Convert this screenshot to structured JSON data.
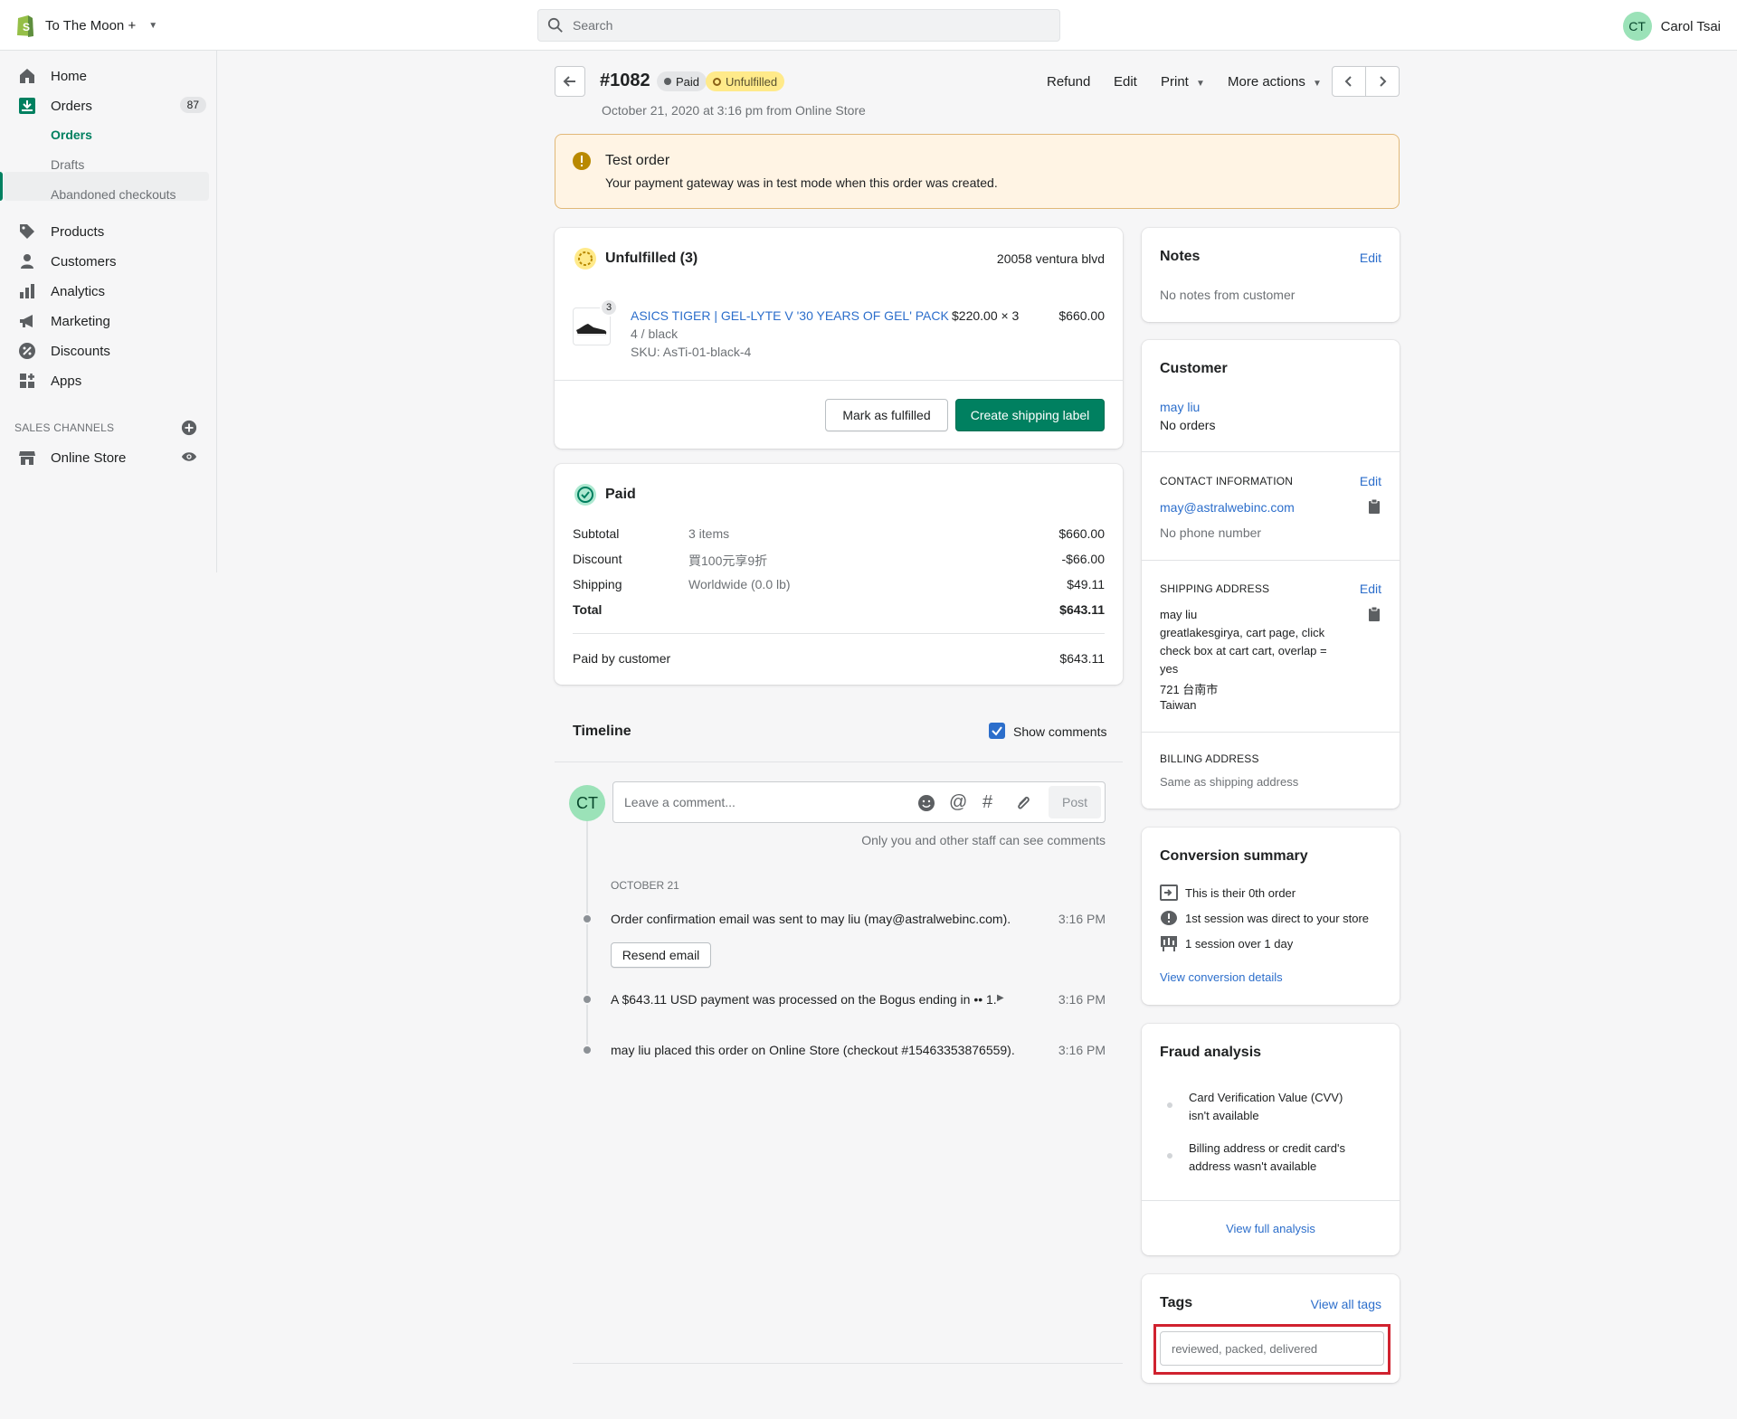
{
  "topbar": {
    "store_name": "To The Moon +",
    "search_placeholder": "Search",
    "user_initials": "CT",
    "user_name": "Carol Tsai"
  },
  "sidebar": {
    "home": "Home",
    "orders": "Orders",
    "orders_count": "87",
    "sub_orders": "Orders",
    "sub_drafts": "Drafts",
    "sub_abandoned": "Abandoned checkouts",
    "products": "Products",
    "customers": "Customers",
    "analytics": "Analytics",
    "marketing": "Marketing",
    "discounts": "Discounts",
    "apps": "Apps",
    "sales_channels": "SALES CHANNELS",
    "online_store": "Online Store"
  },
  "header": {
    "order_number": "#1082",
    "status_paid": "Paid",
    "status_unfulfilled": "Unfulfilled",
    "subline": "October 21, 2020 at 3:16 pm from Online Store",
    "refund": "Refund",
    "edit": "Edit",
    "print": "Print",
    "more_actions": "More actions"
  },
  "banner": {
    "title": "Test order",
    "text": "Your payment gateway was in test mode when this order was created."
  },
  "fulfillment": {
    "title": "Unfulfilled (3)",
    "location": "20058 ventura blvd",
    "qty_badge": "3",
    "product_name": "ASICS TIGER | GEL-LYTE V '30 YEARS OF GEL' PACK",
    "variant": "4 / black",
    "sku": "SKU: AsTi-01-black-4",
    "unit_price": "$220.00 × 3",
    "line_total": "$660.00",
    "mark_fulfilled": "Mark as fulfilled",
    "create_label": "Create shipping label"
  },
  "payment": {
    "title": "Paid",
    "rows": [
      {
        "label": "Subtotal",
        "desc": "3 items",
        "amount": "$660.00"
      },
      {
        "label": "Discount",
        "desc": "買100元享9折",
        "amount": "-$66.00"
      },
      {
        "label": "Shipping",
        "desc": "Worldwide (0.0 lb)",
        "amount": "$49.11"
      },
      {
        "label": "Total",
        "desc": "",
        "amount": "$643.11"
      }
    ],
    "paid_by_label": "Paid by customer",
    "paid_by_amount": "$643.11"
  },
  "timeline": {
    "title": "Timeline",
    "show_comments": "Show comments",
    "avatar": "CT",
    "comment_placeholder": "Leave a comment...",
    "post": "Post",
    "staff_note": "Only you and other staff can see comments",
    "date_header": "OCTOBER 21",
    "events": [
      {
        "text": "Order confirmation email was sent to may liu (may@astralwebinc.com).",
        "time": "3:16 PM"
      },
      {
        "text": "A $643.11 USD payment was processed on the Bogus ending in •• 1.",
        "time": "3:16 PM"
      },
      {
        "text": "may liu placed this order on Online Store (checkout #15463353876559).",
        "time": "3:16 PM"
      }
    ],
    "resend_email": "Resend email"
  },
  "notes": {
    "title": "Notes",
    "edit": "Edit",
    "text": "No notes from customer"
  },
  "customer": {
    "title": "Customer",
    "name": "may liu",
    "orders": "No orders",
    "contact_header": "CONTACT INFORMATION",
    "contact_edit": "Edit",
    "email": "may@astralwebinc.com",
    "phone": "No phone number",
    "shipping_header": "SHIPPING ADDRESS",
    "shipping_edit": "Edit",
    "ship_name": "may liu",
    "ship_line1": "greatlakesgirya, cart page, click",
    "ship_line2": "check box at cart cart, overlap =",
    "ship_line3": "yes",
    "ship_line4": "721 台南市",
    "ship_line5": "Taiwan",
    "billing_header": "BILLING ADDRESS",
    "billing_text": "Same as shipping address"
  },
  "conversion": {
    "title": "Conversion summary",
    "line1": "This is their 0th order",
    "line2": "1st session was direct to your store",
    "line3": "1 session over 1 day",
    "link": "View conversion details"
  },
  "fraud": {
    "title": "Fraud analysis",
    "item1_a": "Card Verification Value (CVV)",
    "item1_b": "isn't available",
    "item2_a": "Billing address or credit card's",
    "item2_b": "address wasn't available",
    "link": "View full analysis"
  },
  "tags": {
    "title": "Tags",
    "view_all": "View all tags",
    "placeholder": "reviewed, packed, delivered"
  },
  "colors": {
    "accent_green": "#008060",
    "link_blue": "#2c6ecb",
    "highlight_red": "#d0222f"
  }
}
